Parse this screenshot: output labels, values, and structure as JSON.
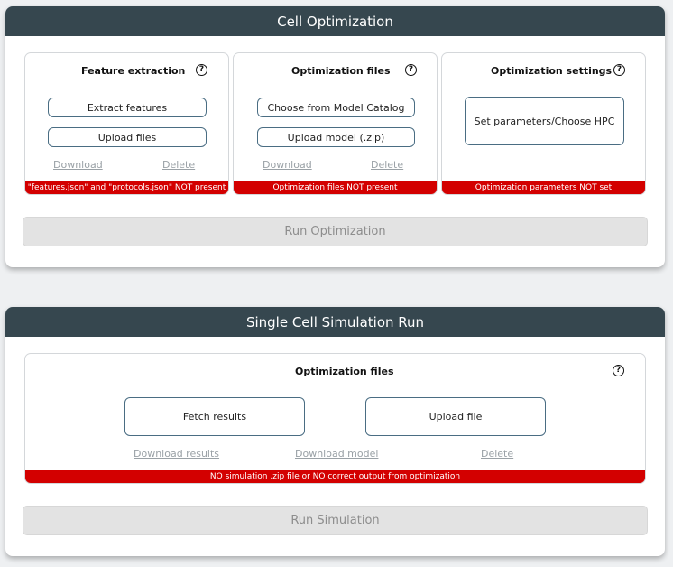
{
  "optimization": {
    "title": "Cell Optimization",
    "feature_extraction": {
      "title": "Feature extraction",
      "help_icon": "?",
      "extract_label": "Extract features",
      "upload_label": "Upload files",
      "download_label": "Download",
      "delete_label": "Delete",
      "status": "\"features.json\" and \"protocols.json\" NOT present"
    },
    "optimization_files": {
      "title": "Optimization files",
      "help_icon": "?",
      "catalog_label": "Choose from Model Catalog",
      "upload_label": "Upload model (.zip)",
      "download_label": "Download",
      "delete_label": "Delete",
      "status": "Optimization files NOT present"
    },
    "optimization_settings": {
      "title": "Optimization settings",
      "help_icon": "?",
      "set_label": "Set parameters/Choose HPC",
      "status": "Optimization parameters NOT set"
    },
    "run_label": "Run Optimization"
  },
  "simulation": {
    "title": "Single Cell Simulation Run",
    "files": {
      "title": "Optimization files",
      "help_icon": "?",
      "fetch_label": "Fetch results",
      "upload_label": "Upload file",
      "download_results_label": "Download results",
      "download_model_label": "Download model",
      "delete_label": "Delete",
      "status": "NO simulation .zip file or NO correct output from optimization"
    },
    "run_label": "Run Simulation"
  },
  "colors": {
    "header_bg": "#36474f",
    "status_red": "#d30000",
    "button_border": "#4a6d83",
    "disabled_bg": "#e3e3e3"
  }
}
